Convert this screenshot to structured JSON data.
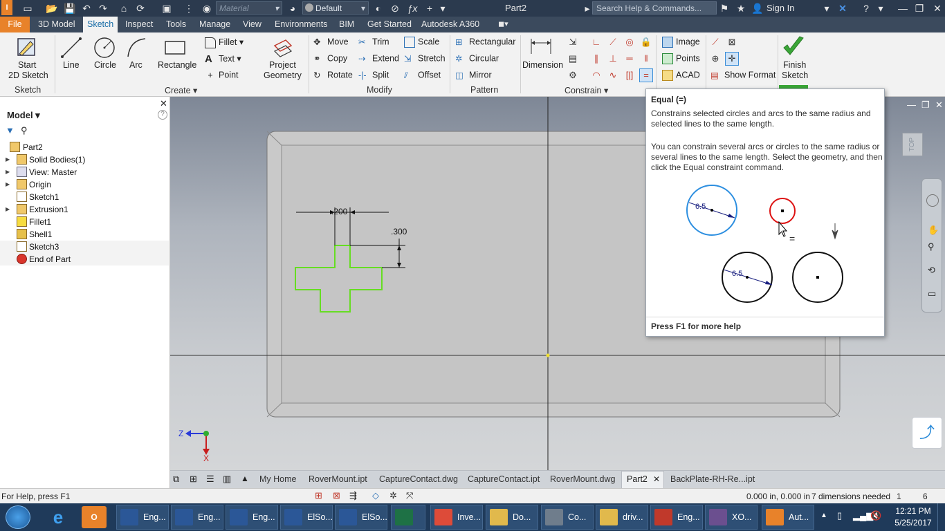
{
  "titlebar": {
    "material": "Material",
    "appearance": "Default",
    "title": "Part2",
    "search_placeholder": "Search Help & Commands...",
    "signin": "Sign In"
  },
  "tabs": [
    "File",
    "3D Model",
    "Sketch",
    "Inspect",
    "Tools",
    "Manage",
    "View",
    "Environments",
    "BIM",
    "Get Started",
    "Autodesk A360"
  ],
  "ribbon": {
    "sketch_panel": {
      "start_line1": "Start",
      "start_line2": "2D Sketch",
      "label": "Sketch"
    },
    "create_panel": {
      "line": "Line",
      "circle": "Circle",
      "arc": "Arc",
      "rectangle": "Rectangle",
      "fillet": "Fillet",
      "text": "Text",
      "point": "Point",
      "project_line1": "Project",
      "project_line2": "Geometry",
      "label": "Create"
    },
    "modify_panel": {
      "move": "Move",
      "trim": "Trim",
      "scale": "Scale",
      "copy": "Copy",
      "extend": "Extend",
      "stretch": "Stretch",
      "rotate": "Rotate",
      "split": "Split",
      "offset": "Offset",
      "label": "Modify"
    },
    "pattern_panel": {
      "rectangular": "Rectangular",
      "circular": "Circular",
      "mirror": "Mirror",
      "label": "Pattern"
    },
    "constrain_panel": {
      "dimension": "Dimension",
      "label": "Constrain"
    },
    "insert_panel": {
      "image": "Image",
      "points": "Points",
      "acad": "ACAD",
      "show_format": "Show Format"
    },
    "exit_panel": {
      "finish_line1": "Finish",
      "finish_line2": "Sketch"
    }
  },
  "browser": {
    "title": "Model",
    "items": [
      {
        "label": "Part2",
        "expandable": false
      },
      {
        "label": "Solid Bodies(1)",
        "expandable": true
      },
      {
        "label": "View: Master",
        "expandable": true
      },
      {
        "label": "Origin",
        "expandable": true
      },
      {
        "label": "Sketch1",
        "expandable": false
      },
      {
        "label": "Extrusion1",
        "expandable": true
      },
      {
        "label": "Fillet1",
        "expandable": false
      },
      {
        "label": "Shell1",
        "expandable": false
      },
      {
        "label": "Sketch3",
        "expandable": false
      },
      {
        "label": "End of Part",
        "expandable": false
      }
    ]
  },
  "canvas": {
    "dim_horizontal": ".200",
    "dim_vertical": ".300",
    "viewcube": "TOP",
    "triad_z": "Z",
    "triad_x": "X"
  },
  "tooltip": {
    "title": "Equal (=)",
    "para1": "Constrains selected circles and arcs to the same radius and selected lines to the same length.",
    "para2": "You can constrain several arcs or circles to the same radius or several lines to the same length. Select the geometry, and then click the Equal constraint command.",
    "dim1": "6.5",
    "dim2": "6.5",
    "equal_sign": "=",
    "footer": "Press F1 for more help"
  },
  "doc_tabs": [
    "My Home",
    "RoverMount.ipt",
    "CaptureContact.dwg",
    "CaptureContact.ipt",
    "RoverMount.dwg",
    "Part2",
    "BackPlate-RH-Re...ipt"
  ],
  "status": {
    "help": "For Help, press F1",
    "coords": "0.000 in, 0.000 in",
    "dims_needed": "7 dimensions needed",
    "count1": "1",
    "count2": "6"
  },
  "taskbar": {
    "items": [
      {
        "label": "Eng...",
        "color": "#2b5797"
      },
      {
        "label": "Eng...",
        "color": "#2b5797"
      },
      {
        "label": "Eng...",
        "color": "#2b5797"
      },
      {
        "label": "ElSo...",
        "color": "#2b5797"
      },
      {
        "label": "ElSo...",
        "color": "#2b5797"
      },
      {
        "label": "",
        "color": "#1e7145"
      },
      {
        "label": "Inve...",
        "color": "#dd4b39"
      },
      {
        "label": "Do...",
        "color": "#e1b94c"
      },
      {
        "label": "Co...",
        "color": "#6f7d8c"
      },
      {
        "label": "driv...",
        "color": "#e1b94c"
      },
      {
        "label": "Eng...",
        "color": "#c0392b"
      },
      {
        "label": "XO...",
        "color": "#6b4f8f"
      },
      {
        "label": "Aut...",
        "color": "#e8822a"
      }
    ],
    "time": "12:21 PM",
    "date": "5/25/2017"
  },
  "colors": {
    "accent": "#1a6ea8",
    "file_tab": "#e8822a",
    "sketch_green": "#66dd22",
    "tooltip_blue_circle": "#2d8fe0",
    "tooltip_red_circle": "#dd1111"
  }
}
